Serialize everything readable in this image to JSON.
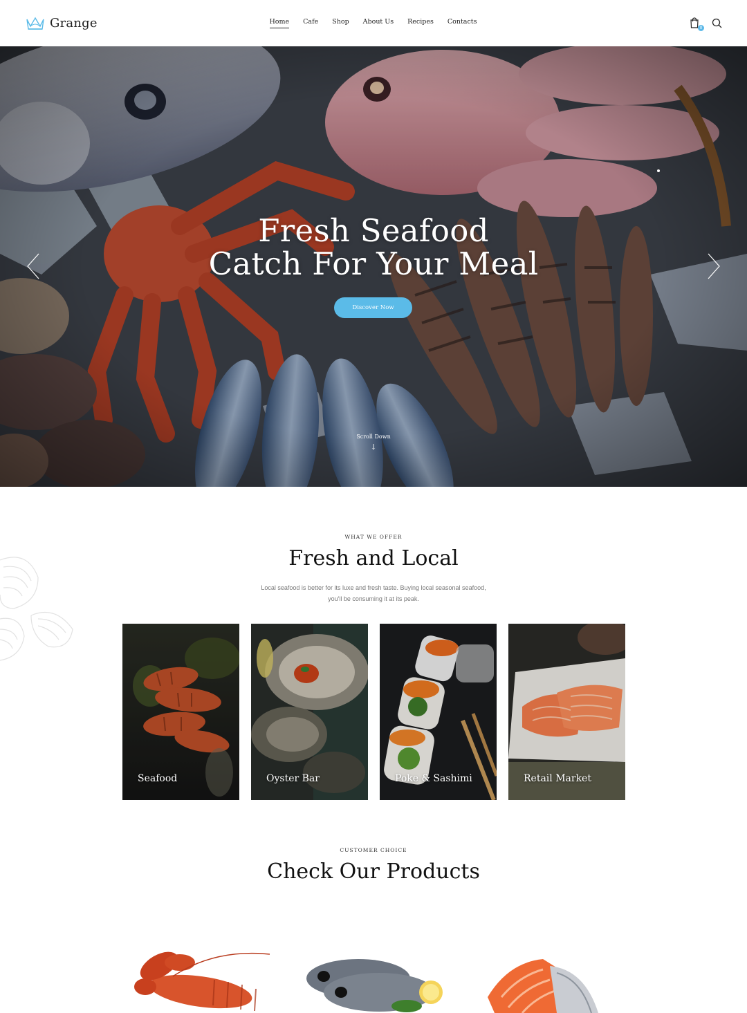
{
  "header": {
    "logo_text": "Grange",
    "nav": [
      {
        "label": "Home",
        "active": true
      },
      {
        "label": "Cafe"
      },
      {
        "label": "Shop"
      },
      {
        "label": "About Us"
      },
      {
        "label": "Recipes"
      },
      {
        "label": "Contacts"
      }
    ],
    "cart_count": "0",
    "icons": [
      "cart-icon",
      "search-icon"
    ]
  },
  "hero": {
    "title_line1": "Fresh Seafood",
    "title_line2": "Catch For Your Meal",
    "button_label": "Discover Now",
    "scroll_label": "Scroll Down",
    "icons": [
      "arrow-left-icon",
      "arrow-right-icon",
      "arrow-down-icon"
    ]
  },
  "offer": {
    "eyebrow": "WHAT WE OFFER",
    "title": "Fresh and Local",
    "description": "Local seafood is better for its luxe and fresh taste. Buying local seasonal seafood, you'll be consuming it at its peak.",
    "cards": [
      {
        "label": "Seafood"
      },
      {
        "label": "Oyster Bar"
      },
      {
        "label": "Poke & Sashimi"
      },
      {
        "label": "Retail Market"
      }
    ]
  },
  "products": {
    "eyebrow": "CUSTOMER CHOICE",
    "title": "Check Our Products"
  },
  "colors": {
    "accent": "#5bbbe8",
    "text": "#111111",
    "muted": "#777777"
  }
}
